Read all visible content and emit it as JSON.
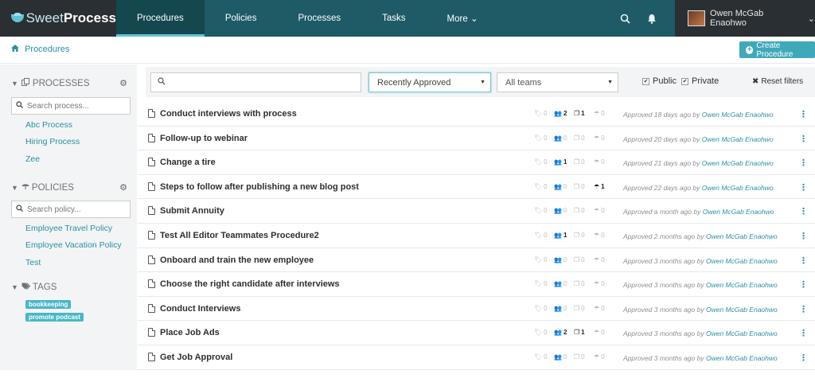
{
  "app": {
    "brand_light": "Sweet",
    "brand_bold": "Process"
  },
  "nav": {
    "items": [
      {
        "label": "Procedures",
        "active": true
      },
      {
        "label": "Policies"
      },
      {
        "label": "Processes"
      },
      {
        "label": "Tasks"
      },
      {
        "label": "More ⌄"
      }
    ],
    "user_name": "Owen McGab Enaohwo",
    "user_caret": "⌄"
  },
  "breadcrumb": {
    "label": "Procedures"
  },
  "create_button": {
    "label": "Create Procedure"
  },
  "sidebar": {
    "processes": {
      "header": "PROCESSES",
      "search_placeholder": "Search process...",
      "items": [
        "Abc Process",
        "Hiring Process",
        "Zee"
      ]
    },
    "policies": {
      "header": "POLICIES",
      "search_placeholder": "Search policy...",
      "items": [
        "Employee Travel Policy",
        "Employee Vacation Policy",
        "Test"
      ]
    },
    "tags": {
      "header": "TAGS",
      "items": [
        "bookkeeping",
        "promote podcast"
      ]
    }
  },
  "filters": {
    "search_value": "",
    "sort_selected": "Recently Approved",
    "team_selected": "All teams",
    "public_label": "Public",
    "private_label": "Private",
    "reset_label": "Reset filters"
  },
  "procedures": [
    {
      "title": "Conduct interviews with process",
      "tags": "0",
      "teams": "2",
      "processes": "1",
      "policies": "0",
      "approved": "Approved 18 days ago by",
      "by": "Owen McGab Enaohwo"
    },
    {
      "title": "Follow-up to webinar",
      "tags": "0",
      "teams": "0",
      "processes": "0",
      "policies": "0",
      "approved": "Approved 20 days ago by",
      "by": "Owen McGab Enaohwo"
    },
    {
      "title": "Change a tire",
      "tags": "0",
      "teams": "1",
      "processes": "0",
      "policies": "0",
      "approved": "Approved 21 days ago by",
      "by": "Owen McGab Enaohwo"
    },
    {
      "title": "Steps to follow after publishing a new blog post",
      "tags": "0",
      "teams": "0",
      "processes": "0",
      "policies": "1",
      "approved": "Approved 22 days ago by",
      "by": "Owen McGab Enaohwo"
    },
    {
      "title": "Submit Annuity",
      "tags": "0",
      "teams": "0",
      "processes": "0",
      "policies": "0",
      "approved": "Approved a month ago by",
      "by": "Owen McGab Enaohwo"
    },
    {
      "title": "Test All Editor Teammates Procedure2",
      "tags": "0",
      "teams": "1",
      "processes": "0",
      "policies": "0",
      "approved": "Approved 2 months ago by",
      "by": "Owen McGab Enaohwo"
    },
    {
      "title": "Onboard and train the new employee",
      "tags": "0",
      "teams": "0",
      "processes": "0",
      "policies": "0",
      "approved": "Approved 3 months ago by",
      "by": "Owen McGab Enaohwo"
    },
    {
      "title": "Choose the right candidate after interviews",
      "tags": "0",
      "teams": "0",
      "processes": "0",
      "policies": "0",
      "approved": "Approved 3 months ago by",
      "by": "Owen McGab Enaohwo"
    },
    {
      "title": "Conduct Interviews",
      "tags": "0",
      "teams": "0",
      "processes": "0",
      "policies": "0",
      "approved": "Approved 3 months ago by",
      "by": "Owen McGab Enaohwo"
    },
    {
      "title": "Place Job Ads",
      "tags": "0",
      "teams": "2",
      "processes": "1",
      "policies": "0",
      "approved": "Approved 3 months ago by",
      "by": "Owen McGab Enaohwo"
    },
    {
      "title": "Get Job Approval",
      "tags": "0",
      "teams": "0",
      "processes": "0",
      "policies": "0",
      "approved": "Approved 3 months ago by",
      "by": "Owen McGab Enaohwo"
    }
  ],
  "colors": {
    "nav_bg": "#1e5b66",
    "accent": "#3fa9b9",
    "link": "#2a8fa8",
    "dark": "#2a2f33"
  }
}
